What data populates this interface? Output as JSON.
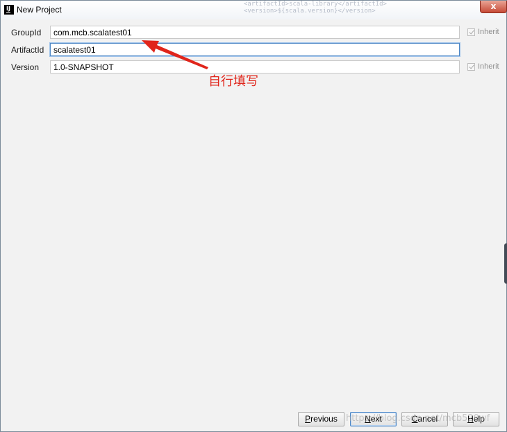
{
  "window": {
    "title": "New Project",
    "close_glyph": "x",
    "app_icon_text": "IJ"
  },
  "background_code": {
    "line1": "<artifactId>scala-library</artifactId>",
    "line2": "<version>${scala.version}</version>"
  },
  "form": {
    "group_id": {
      "label": "GroupId",
      "value": "com.mcb.scalatest01",
      "inherit_label": "Inherit",
      "inherit_checked": true
    },
    "artifact_id": {
      "label": "ArtifactId",
      "value": "scalatest01"
    },
    "version": {
      "label": "Version",
      "value": "1.0-SNAPSHOT",
      "inherit_label": "Inherit",
      "inherit_checked": true
    }
  },
  "annotation": {
    "text": "自行填写",
    "color": "#e0251b"
  },
  "buttons": {
    "previous": {
      "mnemonic": "P",
      "rest": "revious"
    },
    "next": {
      "mnemonic": "N",
      "rest": "ext"
    },
    "cancel": {
      "mnemonic": "C",
      "rest": "ancel"
    },
    "help": {
      "mnemonic": "H",
      "rest": "elp"
    }
  },
  "watermark": "https://blog.csdn.net/mcb520wf",
  "colors": {
    "focus_border": "#4f88c6",
    "close_button": "#c74b38",
    "dialog_background": "#f2f2f2"
  },
  "icons": [
    "app-icon",
    "close-icon",
    "checkbox-check-icon",
    "red-arrow-icon"
  ]
}
